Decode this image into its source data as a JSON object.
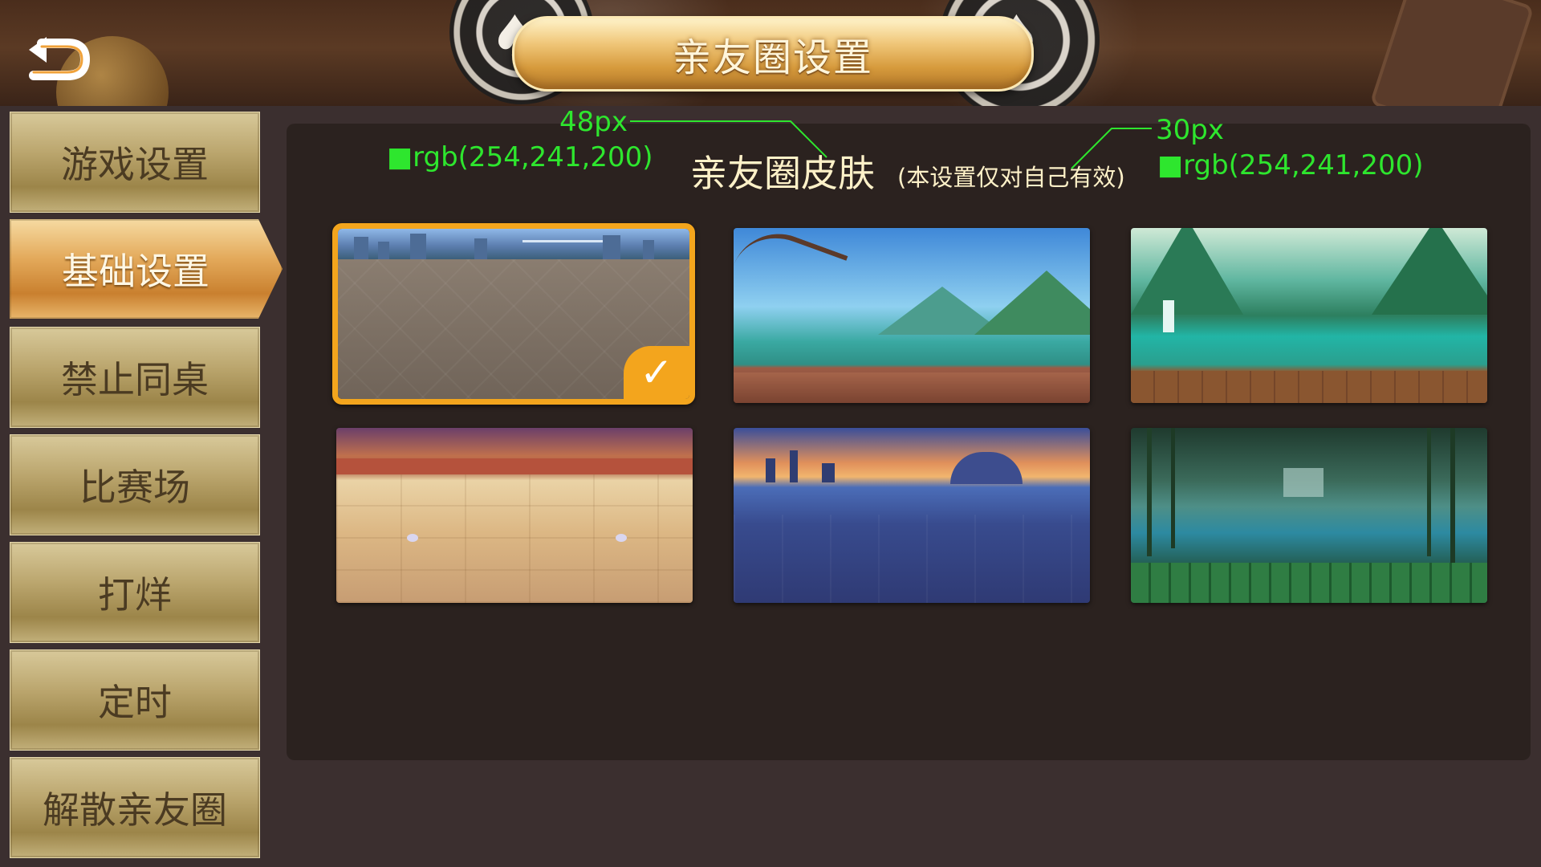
{
  "header": {
    "title": "亲友圈设置",
    "back_icon": "back-arrow-icon"
  },
  "sidebar": {
    "items": [
      {
        "label": "游戏设置",
        "active": false
      },
      {
        "label": "基础设置",
        "active": true
      },
      {
        "label": "禁止同桌",
        "active": false
      },
      {
        "label": "比赛场",
        "active": false
      },
      {
        "label": "打烊",
        "active": false
      },
      {
        "label": "定时",
        "active": false
      },
      {
        "label": "解散亲友圈",
        "active": false
      }
    ]
  },
  "panel": {
    "title": "亲友圈皮肤",
    "note": "(本设置仅对自己有效)",
    "spec_title_size": "48px",
    "spec_title_color": "■rgb(254,241,200)",
    "spec_note_size": "30px",
    "spec_note_color": "■rgb(254,241,200)"
  },
  "skins": {
    "selected_index": 0,
    "items": [
      {
        "name": "city-bridge-skin"
      },
      {
        "name": "plum-lake-skin"
      },
      {
        "name": "waterfall-lake-skin"
      },
      {
        "name": "palace-terrace-skin"
      },
      {
        "name": "city-sunset-skin"
      },
      {
        "name": "bamboo-river-skin"
      }
    ],
    "check_icon": "checkmark-icon"
  },
  "colors": {
    "accent": "#f3a51d",
    "text_light": "#fef1c8",
    "spec_annotation": "#2ee62e"
  }
}
